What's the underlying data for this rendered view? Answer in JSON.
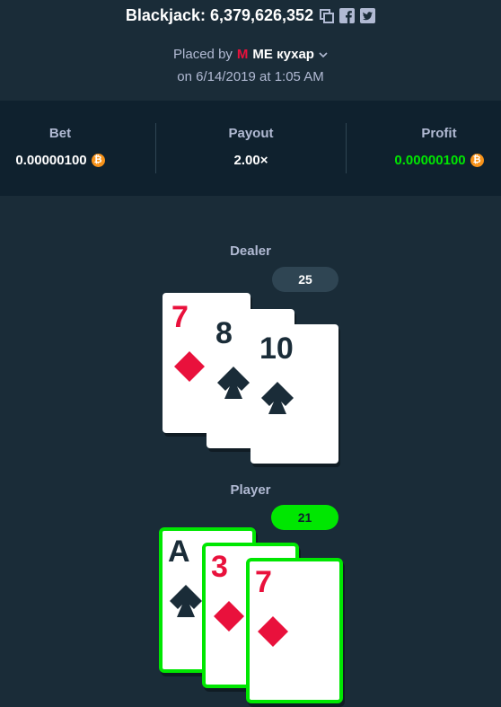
{
  "header": {
    "title": "Blackjack: 6,379,626,352",
    "placed_by_label": "Placed by",
    "user_badge": "M",
    "username": "ME кухар",
    "date": "on 6/14/2019 at 1:05 AM"
  },
  "stats": {
    "bet_label": "Bet",
    "bet_value": "0.00000100",
    "payout_label": "Payout",
    "payout_value": "2.00×",
    "profit_label": "Profit",
    "profit_value": "0.00000100",
    "currency_symbol": "₿"
  },
  "dealer": {
    "label": "Dealer",
    "score": "25",
    "cards": [
      {
        "rank": "7",
        "suit": "diamond-icon",
        "color": "#e9113c"
      },
      {
        "rank": "8",
        "suit": "spade-icon",
        "color": "#1a2c38"
      },
      {
        "rank": "10",
        "suit": "spade-icon",
        "color": "#1a2c38"
      }
    ]
  },
  "player": {
    "label": "Player",
    "score": "21",
    "cards": [
      {
        "rank": "A",
        "suit": "spade-icon",
        "color": "#1a2c38"
      },
      {
        "rank": "3",
        "suit": "diamond-icon",
        "color": "#e9113c"
      },
      {
        "rank": "7",
        "suit": "diamond-icon",
        "color": "#e9113c"
      }
    ]
  },
  "colors": {
    "background": "#1a2c38",
    "panel": "#0f212e",
    "win": "#00e701",
    "red_suit": "#e9113c"
  }
}
